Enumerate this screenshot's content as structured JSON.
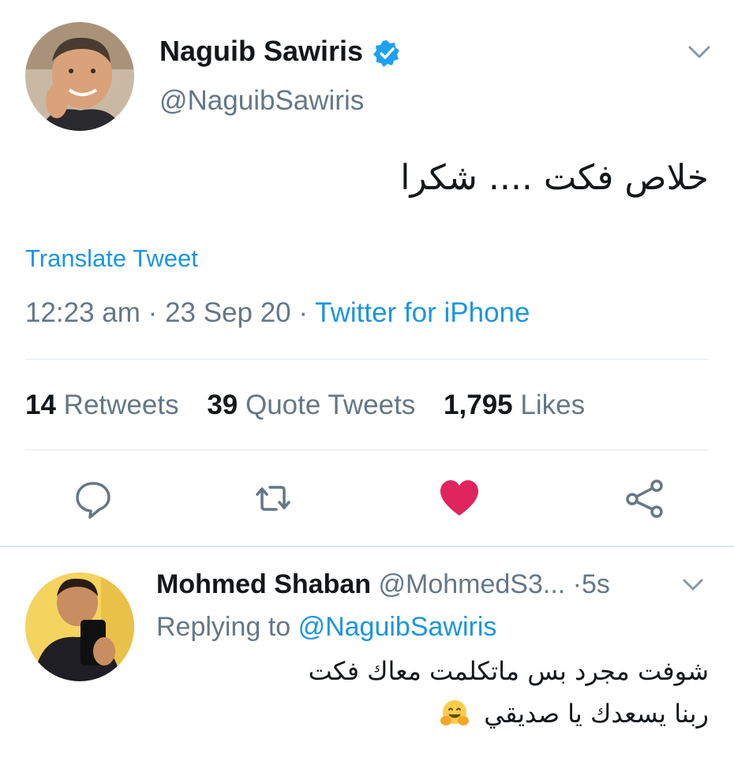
{
  "tweet": {
    "author_name": "Naguib Sawiris",
    "author_handle": "@NaguibSawiris",
    "text": "خلاص فكت .... شكرا",
    "translate_label": "Translate Tweet",
    "time": "12:23 am",
    "date": "23 Sep 20",
    "separator": "·",
    "source": "Twitter for iPhone",
    "stats": [
      {
        "count": "14",
        "label": "Retweets"
      },
      {
        "count": "39",
        "label": "Quote Tweets"
      },
      {
        "count": "1,795",
        "label": "Likes"
      }
    ],
    "actions": {
      "reply_icon": "reply-icon",
      "retweet_icon": "retweet-icon",
      "like_icon": "heart-icon",
      "share_icon": "share-icon",
      "like_color": "#e0245e"
    },
    "verified_color": "#1da1f2"
  },
  "reply": {
    "author_name": "Mohmed Shaban",
    "author_handle": "@MohmedS3...",
    "time_separator": "·",
    "time": "5s",
    "replying_prefix": "Replying to",
    "replying_to": "@NaguibSawiris",
    "text_line_1": "شوفت مجرد بس ماتكلمت معاك فكت",
    "text_line_2": "ربنا يسعدك يا صديقي",
    "emoji": "hugging-face-emoji"
  },
  "colors": {
    "link": "#1b95e0",
    "secondary_text": "#657786",
    "divider": "#e1e8ed"
  }
}
